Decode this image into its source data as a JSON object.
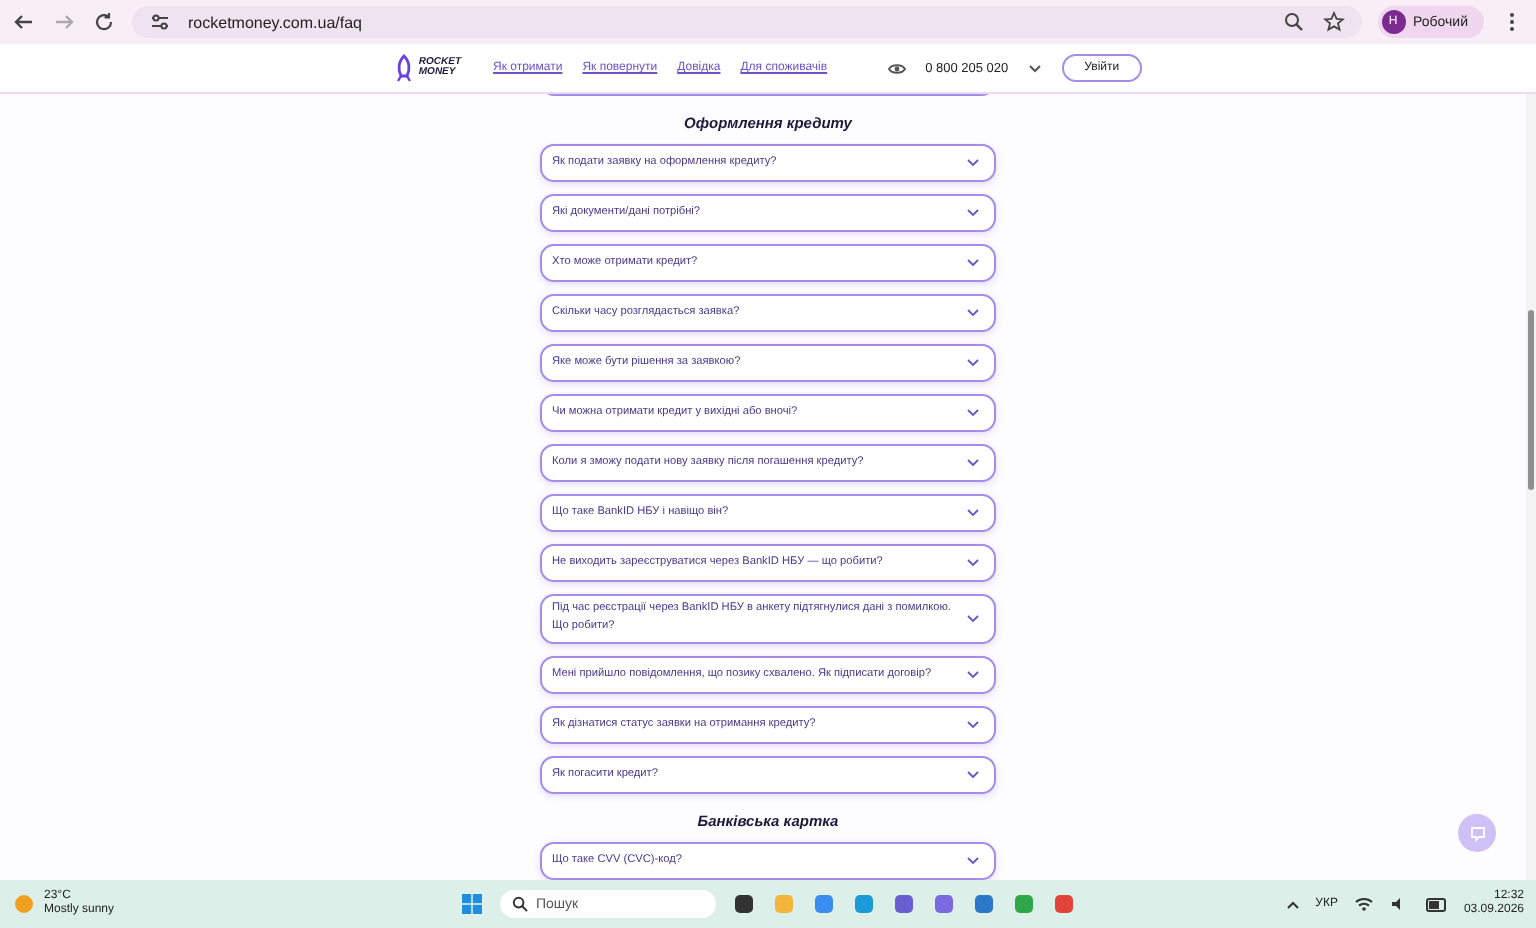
{
  "browser": {
    "url": "rocketmoney.com.ua/faq",
    "profile_initial": "Н",
    "profile_name": "Робочий"
  },
  "header": {
    "logo": [
      "ROCKET",
      "MONEY"
    ],
    "nav": [
      "Як отримати",
      "Як повернути",
      "Довідка",
      "Для споживачів"
    ],
    "phone": "0 800 205 020",
    "login": "Увійти"
  },
  "sections": [
    {
      "title": "Оформлення кредиту",
      "items": [
        {
          "question": "Як подати заявку на оформлення кредиту?"
        },
        {
          "question": "Які документи/дані потрібні?"
        },
        {
          "question": "Хто може отримати кредит?"
        },
        {
          "question": "Скільки часу розглядається заявка?"
        },
        {
          "question": "Яке може бути рішення за заявкою?"
        },
        {
          "question": "Чи можна отримати кредит у вихідні або вночі?"
        },
        {
          "question": "Коли я зможу подати нову заявку після погашення кредиту?"
        },
        {
          "question": "Що таке BankID НБУ і навіщо він?"
        },
        {
          "question": "Не виходить зареєструватися через BankID НБУ — що робити?"
        },
        {
          "question": "Під час реєстрації через BankID НБУ в анкету підтягнулися дані з помилкою. Що робити?"
        },
        {
          "question": "Мені прийшло повідомлення, що позику схвалено. Як підписати договір?"
        },
        {
          "question": "Як дізнатися статус заявки на отримання кредиту?"
        },
        {
          "question": "Як погасити кредит?"
        }
      ]
    },
    {
      "title": "Банківська картка",
      "items": [
        {
          "question": "Що таке CVV (CVC)-код?"
        }
      ]
    }
  ],
  "taskbar": {
    "temperature": "23°C",
    "weather": "Mostly sunny",
    "search_placeholder": "Пошук",
    "language": "УКР",
    "time": "12:32",
    "date": "03.09.2026"
  }
}
